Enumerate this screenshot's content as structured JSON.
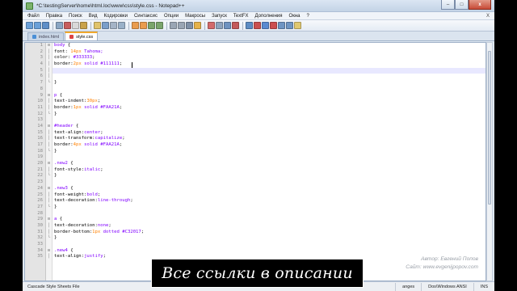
{
  "window": {
    "title": "*C:\\testingServer\\home\\html.loc\\www\\css\\style.css - Notepad++",
    "minimize_label": "–",
    "maximize_label": "□",
    "close_label": "x"
  },
  "menu": [
    "Файл",
    "Правка",
    "Поиск",
    "Вид",
    "Кодировки",
    "Синтаксис",
    "Опции",
    "Макросы",
    "Запуск",
    "TextFX",
    "Дополнения",
    "Окна",
    "?"
  ],
  "menu_close": "X",
  "toolbar": {
    "button_colors": [
      "#6aa0d8",
      "#6aa0d8",
      "#5f8fc8",
      "#8aa6c4",
      "#c75d5d",
      "#d9d9d9",
      "#c9a24a",
      "#e0c36a",
      "#7a9ec9",
      "#a5b4c6",
      "#9ab1c8",
      "#ea9c4e",
      "#ea9c4e",
      "#7aa56b",
      "#7aa56b",
      "#9aa6b4",
      "#9aa6b4",
      "#7f90a6",
      "#e5b24a",
      "#d36a6a",
      "#8ea4bd",
      "#6f93bf",
      "#c45a5a",
      "#5d8cc4",
      "#c95050",
      "#5a8ad0",
      "#cc4e4e",
      "#6f95c2",
      "#6f95c2",
      "#e0c870"
    ]
  },
  "tabs": [
    {
      "label": "index.html",
      "active": false
    },
    {
      "label": "style.css",
      "active": true
    }
  ],
  "editor": {
    "lines": [
      {
        "no": "1",
        "fold": "⊟",
        "parts": [
          {
            "t": "body",
            "c": "sel"
          },
          {
            "t": " {",
            "c": "brace"
          }
        ]
      },
      {
        "no": "2",
        "fold": "│",
        "parts": [
          {
            "t": "font",
            "c": "prop"
          },
          {
            "t": ": ",
            "c": "brace"
          },
          {
            "t": "14px",
            "c": "num"
          },
          {
            "t": " Tahoma;",
            "c": "val"
          }
        ]
      },
      {
        "no": "3",
        "fold": "│",
        "parts": [
          {
            "t": "color",
            "c": "prop"
          },
          {
            "t": ": ",
            "c": "brace"
          },
          {
            "t": "#333333",
            "c": "hex"
          },
          {
            "t": ";",
            "c": "brace"
          }
        ]
      },
      {
        "no": "4",
        "fold": "│",
        "parts": [
          {
            "t": "border",
            "c": "prop"
          },
          {
            "t": ":",
            "c": "brace"
          },
          {
            "t": "2px",
            "c": "num"
          },
          {
            "t": " solid ",
            "c": "val"
          },
          {
            "t": "#111111",
            "c": "hex"
          },
          {
            "t": ";",
            "c": "brace"
          }
        ]
      },
      {
        "no": "5",
        "fold": "│",
        "current": true,
        "parts": []
      },
      {
        "no": "6",
        "fold": "│",
        "parts": []
      },
      {
        "no": "7",
        "fold": "└",
        "parts": [
          {
            "t": "}",
            "c": "brace"
          }
        ]
      },
      {
        "no": "8",
        "fold": "",
        "parts": []
      },
      {
        "no": "9",
        "fold": "⊟",
        "parts": [
          {
            "t": "p",
            "c": "sel"
          },
          {
            "t": " {",
            "c": "brace"
          }
        ]
      },
      {
        "no": "10",
        "fold": "│",
        "parts": [
          {
            "t": "text-indent",
            "c": "prop"
          },
          {
            "t": ":",
            "c": "brace"
          },
          {
            "t": "30px",
            "c": "num"
          },
          {
            "t": ";",
            "c": "brace"
          }
        ]
      },
      {
        "no": "11",
        "fold": "│",
        "parts": [
          {
            "t": "border",
            "c": "prop"
          },
          {
            "t": ":",
            "c": "brace"
          },
          {
            "t": "1px",
            "c": "num"
          },
          {
            "t": " solid ",
            "c": "val"
          },
          {
            "t": "#FAA21A",
            "c": "hex"
          },
          {
            "t": ";",
            "c": "brace"
          }
        ]
      },
      {
        "no": "12",
        "fold": "└",
        "parts": [
          {
            "t": "}",
            "c": "brace"
          }
        ]
      },
      {
        "no": "13",
        "fold": "",
        "parts": []
      },
      {
        "no": "14",
        "fold": "⊟",
        "parts": [
          {
            "t": "#header",
            "c": "sel"
          },
          {
            "t": " {",
            "c": "brace"
          }
        ]
      },
      {
        "no": "15",
        "fold": "│",
        "parts": [
          {
            "t": "text-align",
            "c": "prop"
          },
          {
            "t": ":",
            "c": "brace"
          },
          {
            "t": "center",
            "c": "val"
          },
          {
            "t": ";",
            "c": "brace"
          }
        ]
      },
      {
        "no": "16",
        "fold": "│",
        "parts": [
          {
            "t": "text-transform",
            "c": "prop"
          },
          {
            "t": ":",
            "c": "brace"
          },
          {
            "t": "capitalize",
            "c": "val"
          },
          {
            "t": ";",
            "c": "brace"
          }
        ]
      },
      {
        "no": "17",
        "fold": "│",
        "parts": [
          {
            "t": "border",
            "c": "prop"
          },
          {
            "t": ":",
            "c": "brace"
          },
          {
            "t": "4px",
            "c": "num"
          },
          {
            "t": " solid ",
            "c": "val"
          },
          {
            "t": "#FAA21A",
            "c": "hex"
          },
          {
            "t": ";",
            "c": "brace"
          }
        ]
      },
      {
        "no": "18",
        "fold": "└",
        "parts": [
          {
            "t": "}",
            "c": "brace"
          }
        ]
      },
      {
        "no": "19",
        "fold": "",
        "parts": []
      },
      {
        "no": "20",
        "fold": "⊟",
        "parts": [
          {
            "t": ".new2",
            "c": "sel"
          },
          {
            "t": " {",
            "c": "brace"
          }
        ]
      },
      {
        "no": "21",
        "fold": "│",
        "parts": [
          {
            "t": "font-style",
            "c": "prop"
          },
          {
            "t": ":",
            "c": "brace"
          },
          {
            "t": "italic",
            "c": "val"
          },
          {
            "t": ";",
            "c": "brace"
          }
        ]
      },
      {
        "no": "22",
        "fold": "└",
        "parts": [
          {
            "t": "}",
            "c": "brace"
          }
        ]
      },
      {
        "no": "23",
        "fold": "",
        "parts": []
      },
      {
        "no": "24",
        "fold": "⊟",
        "parts": [
          {
            "t": ".new3",
            "c": "sel"
          },
          {
            "t": " {",
            "c": "brace"
          }
        ]
      },
      {
        "no": "25",
        "fold": "│",
        "parts": [
          {
            "t": "font-weight",
            "c": "prop"
          },
          {
            "t": ":",
            "c": "brace"
          },
          {
            "t": "bold",
            "c": "val"
          },
          {
            "t": ";",
            "c": "brace"
          }
        ]
      },
      {
        "no": "26",
        "fold": "│",
        "parts": [
          {
            "t": "text-decoration",
            "c": "prop"
          },
          {
            "t": ":",
            "c": "brace"
          },
          {
            "t": "line-through",
            "c": "val"
          },
          {
            "t": ";",
            "c": "brace"
          }
        ]
      },
      {
        "no": "27",
        "fold": "└",
        "parts": [
          {
            "t": "}",
            "c": "brace"
          }
        ]
      },
      {
        "no": "28",
        "fold": "",
        "parts": []
      },
      {
        "no": "29",
        "fold": "⊟",
        "parts": [
          {
            "t": "a",
            "c": "sel"
          },
          {
            "t": " {",
            "c": "brace"
          }
        ]
      },
      {
        "no": "30",
        "fold": "│",
        "parts": [
          {
            "t": "text-decoration",
            "c": "prop"
          },
          {
            "t": ":",
            "c": "brace"
          },
          {
            "t": "none",
            "c": "val"
          },
          {
            "t": ";",
            "c": "brace"
          }
        ]
      },
      {
        "no": "31",
        "fold": "│",
        "parts": [
          {
            "t": "border-bottom",
            "c": "prop"
          },
          {
            "t": ":",
            "c": "brace"
          },
          {
            "t": "1px",
            "c": "num"
          },
          {
            "t": " dotted ",
            "c": "val"
          },
          {
            "t": "#C32017",
            "c": "hex"
          },
          {
            "t": ";",
            "c": "brace"
          }
        ]
      },
      {
        "no": "32",
        "fold": "└",
        "parts": [
          {
            "t": "}",
            "c": "brace"
          }
        ]
      },
      {
        "no": "33",
        "fold": "",
        "parts": []
      },
      {
        "no": "34",
        "fold": "⊟",
        "parts": [
          {
            "t": ".new4",
            "c": "sel"
          },
          {
            "t": " {",
            "c": "brace"
          }
        ]
      },
      {
        "no": "35",
        "fold": "│",
        "parts": [
          {
            "t": "text-align",
            "c": "prop"
          },
          {
            "t": ":",
            "c": "brace"
          },
          {
            "t": "justify",
            "c": "val"
          },
          {
            "t": ";",
            "c": "brace"
          }
        ]
      }
    ]
  },
  "status": {
    "file_type": "Cascade Style Sheets File",
    "changes": "anges",
    "eol_encoding": "Dos\\Windows  ANSI",
    "mode": "INS"
  },
  "credit": {
    "author": "Автор: Евгений Попов",
    "site": "Сайт: www.evgenijpopov.com"
  },
  "banner": "Все ссылки в описании",
  "colors": {
    "selector": "#8000ff",
    "number": "#ff8000",
    "active_tab_accent": "#f1a82b"
  }
}
